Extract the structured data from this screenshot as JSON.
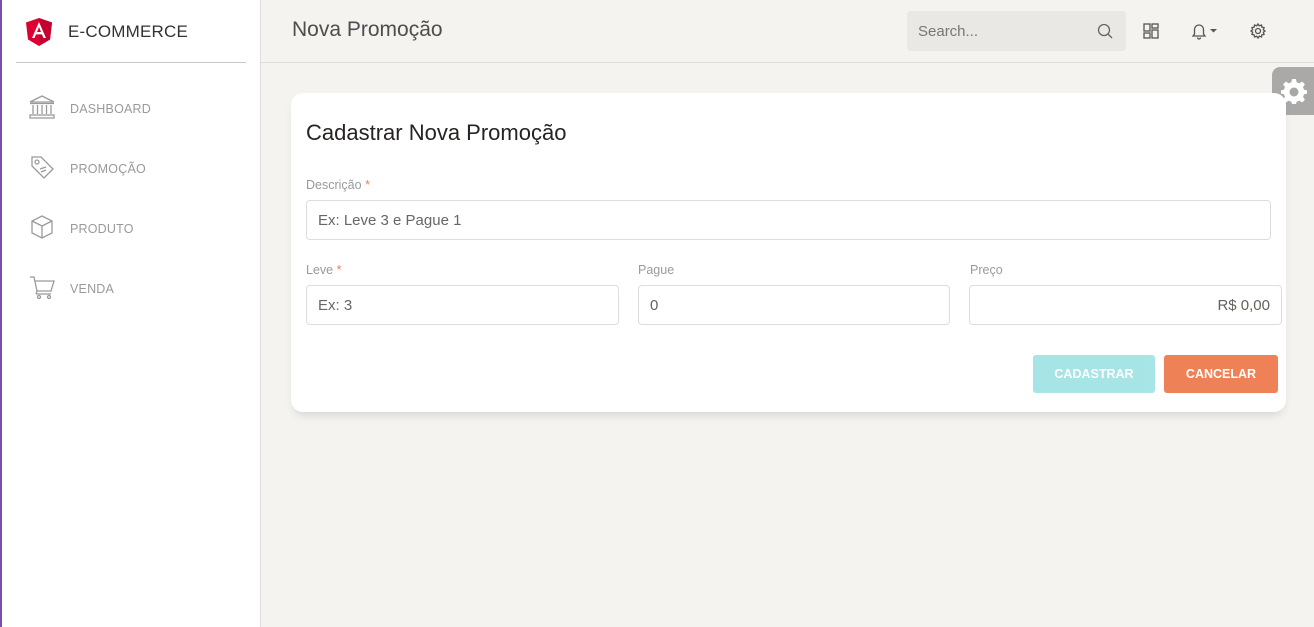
{
  "brand": {
    "name": "E-COMMERCE",
    "logo_icon": "angular-logo-icon",
    "accent_color": "#dd0031"
  },
  "sidebar": {
    "items": [
      {
        "label": "DASHBOARD",
        "icon": "bank-icon"
      },
      {
        "label": "PROMOÇÃO",
        "icon": "tag-icon"
      },
      {
        "label": "PRODUTO",
        "icon": "box-icon"
      },
      {
        "label": "VENDA",
        "icon": "cart-icon"
      }
    ]
  },
  "header": {
    "title": "Nova Promoção",
    "search_placeholder": "Search...",
    "icons": [
      "search-icon",
      "grid-icon",
      "bell-icon",
      "gear-icon"
    ]
  },
  "form": {
    "title": "Cadastrar Nova Promoção",
    "descricao": {
      "label": "Descrição",
      "required_mark": "*",
      "placeholder": "Ex: Leve 3 e Pague 1"
    },
    "leve": {
      "label": "Leve",
      "required_mark": "*",
      "placeholder": "Ex: 3"
    },
    "pague": {
      "label": "Pague",
      "value": "0"
    },
    "preco": {
      "label": "Preço",
      "value": "R$ 0,00"
    },
    "submit_label": "CADASTRAR",
    "cancel_label": "CANCELAR"
  },
  "colors": {
    "primary": "#51cbce",
    "danger": "#ef8157",
    "background": "#f4f3ef"
  }
}
